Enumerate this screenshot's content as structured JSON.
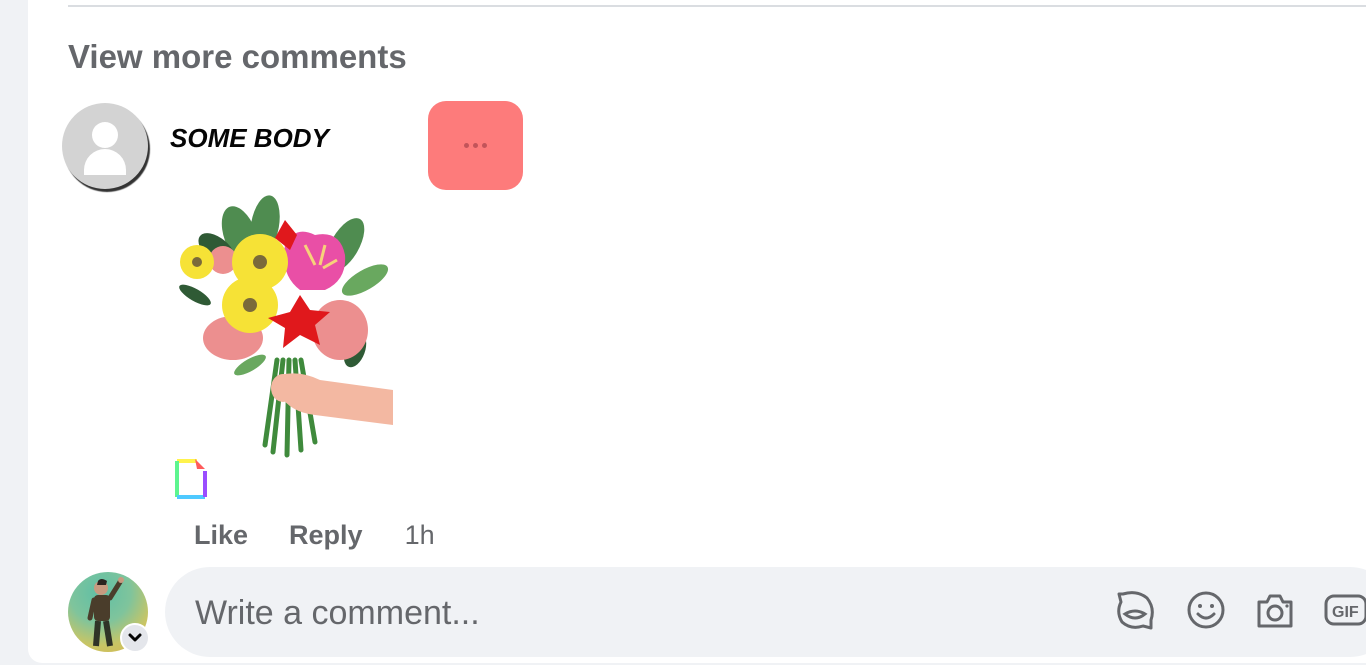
{
  "thread": {
    "view_more_label": "View more comments"
  },
  "comment": {
    "author": "SOME BODY",
    "more_icon": "ellipsis-icon",
    "sticker": "flower-bouquet-sticker",
    "attachment_icon": "gif-placeholder-icon",
    "actions": {
      "like_label": "Like",
      "reply_label": "Reply",
      "timestamp": "1h"
    }
  },
  "composer": {
    "placeholder": "Write a comment...",
    "value": "",
    "avatar": "user-avatar",
    "tools": [
      {
        "name": "avatar-sticker-icon"
      },
      {
        "name": "emoji-icon"
      },
      {
        "name": "camera-icon"
      },
      {
        "name": "gif-icon",
        "label": "GIF"
      }
    ]
  },
  "colors": {
    "page_bg": "#f0f2f5",
    "card_bg": "#ffffff",
    "secondary_text": "#65676b",
    "more_button_bg": "#fd7b7b",
    "input_bg": "#f0f2f5"
  }
}
